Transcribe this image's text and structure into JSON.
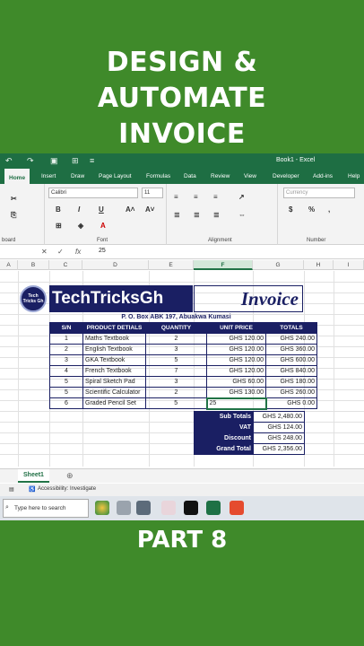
{
  "headline": {
    "line1": "DESIGN &",
    "line2": "AUTOMATE",
    "line3": "INVOICE",
    "part": "PART 8"
  },
  "excel": {
    "window_title": "Book1 - Excel",
    "tabs": [
      "Home",
      "Insert",
      "Draw",
      "Page Layout",
      "Formulas",
      "Data",
      "Review",
      "View",
      "Developer",
      "Add-ins",
      "Help"
    ],
    "ribbon": {
      "font_name": "Calibri",
      "font_size": "11",
      "number_format": "Currency",
      "group_clipboard": "board",
      "group_font": "Font",
      "group_alignment": "Alignment",
      "group_number": "Number",
      "bold": "B",
      "italic": "I",
      "underline": "U",
      "currency_symbol": "$",
      "percent": "%"
    },
    "formula_bar": {
      "value": "25"
    },
    "columns": [
      "A",
      "B",
      "C",
      "D",
      "E",
      "F",
      "G",
      "H",
      "I"
    ],
    "selected_column": "F",
    "invoice": {
      "company": "TechTricksGh",
      "logo_text": "Tech Tricks Gh",
      "title": "Invoice",
      "address": "P. O. Box ABK 197, Abuakwa Kumasi",
      "headers": [
        "S/N",
        "PRODUCT DETIALS",
        "QUANTITY",
        "UNIT PRICE",
        "TOTALS"
      ],
      "rows": [
        {
          "sn": "1",
          "product": "Maths Textbook",
          "qty": "2",
          "price": "GHS 120.00",
          "total": "GHS 240.00"
        },
        {
          "sn": "2",
          "product": "English Textbook",
          "qty": "3",
          "price": "GHS 120.00",
          "total": "GHS 360.00"
        },
        {
          "sn": "3",
          "product": "GKA Textbook",
          "qty": "5",
          "price": "GHS 120.00",
          "total": "GHS 600.00"
        },
        {
          "sn": "4",
          "product": "French Textbook",
          "qty": "7",
          "price": "GHS 120.00",
          "total": "GHS 840.00"
        },
        {
          "sn": "5",
          "product": "Spiral Sketch Pad",
          "qty": "3",
          "price": "GHS 60.00",
          "total": "GHS 180.00"
        },
        {
          "sn": "5",
          "product": "Scientific Calculator",
          "qty": "2",
          "price": "GHS 130.00",
          "total": "GHS 260.00"
        },
        {
          "sn": "6",
          "product": "Graded Pencil Set",
          "qty": "5",
          "price": "25",
          "total": "GHS 0.00"
        }
      ],
      "summary": [
        {
          "label": "Sub Totals",
          "value": "GHS 2,480.00"
        },
        {
          "label": "VAT",
          "value": "GHS 124.00"
        },
        {
          "label": "Discount",
          "value": "GHS 248.00"
        },
        {
          "label": "Grand Total",
          "value": "GHS 2,356.00"
        }
      ]
    },
    "sheet_tab": "Sheet1",
    "status": "Accessibility: Investigate",
    "taskbar_search": "Type here to search"
  }
}
